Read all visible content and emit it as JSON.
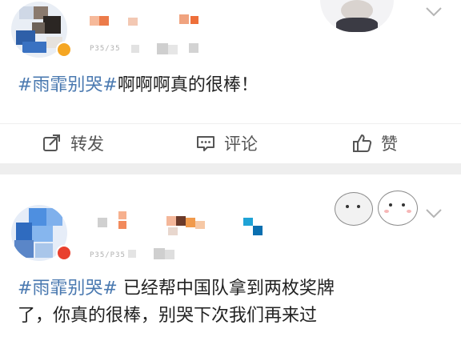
{
  "feed": {
    "posts": [
      {
        "time_fragment": "P35/35",
        "topic": "#雨霏别哭#",
        "text": "啊啊啊真的很棒！",
        "actions": {
          "repost_label": "转发",
          "comment_label": "评论",
          "like_label": "赞"
        }
      },
      {
        "time_fragment": "P35/P35",
        "topic": "#雨霏别哭#",
        "text_line1": " 已经帮中国队拿到两枚奖牌",
        "text_line2": "了，你真的很棒，别哭下次我们再来过"
      }
    ]
  },
  "colors": {
    "topic": "#4a79b0",
    "separator": "#eeeeee",
    "icon": "#555555"
  },
  "icons": {
    "repost": "share-box-icon",
    "comment": "comment-bubble-icon",
    "like": "thumbs-up-icon",
    "menu": "chevron-down-icon"
  }
}
